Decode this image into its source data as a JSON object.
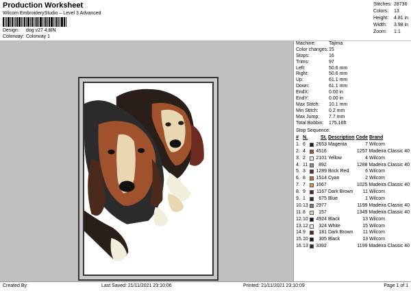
{
  "header": {
    "title": "Production Worksheet",
    "subtitle": "Wilcom EmbroideryStudio – Level 3 Advanced",
    "design_label": "Design:",
    "design_value": "dog v27 4,8IN",
    "colorway_label": "Colorway:",
    "colorway_value": "Colorway 1"
  },
  "stats": [
    {
      "k": "Stitches:",
      "v": "28736"
    },
    {
      "k": "Colors:",
      "v": "13"
    },
    {
      "k": "Height:",
      "v": "4.81 in"
    },
    {
      "k": "Width:",
      "v": "3.98 in"
    },
    {
      "k": "Zoom:",
      "v": "1:1"
    }
  ],
  "properties": [
    {
      "k": "Machine:",
      "v": "Tajima"
    },
    {
      "k": "Color changes:",
      "v": "15"
    },
    {
      "k": "Stops:",
      "v": "16"
    },
    {
      "k": "Trims:",
      "v": "97"
    },
    {
      "k": "Left:",
      "v": "50.6 mm"
    },
    {
      "k": "Right:",
      "v": "50.6 mm"
    },
    {
      "k": "Up:",
      "v": "61.1 mm"
    },
    {
      "k": "Down:",
      "v": "61.1 mm"
    },
    {
      "k": "EndX:",
      "v": "0.00 in"
    },
    {
      "k": "EndY:",
      "v": "0.00 in"
    },
    {
      "k": "Max Stitch:",
      "v": "10.1 mm"
    },
    {
      "k": "Min Stitch:",
      "v": "0.2 mm"
    },
    {
      "k": "Max Jump:",
      "v": "7.7 mm"
    },
    {
      "k": "Total Bobbin:",
      "v": "175.16ft"
    }
  ],
  "stop_sequence": {
    "title": "Stop Sequence:",
    "headers": {
      "num": "#",
      "n": "N.",
      "st": "St.",
      "desc": "Description",
      "code": "Code",
      "brand": "Brand"
    },
    "rows": [
      {
        "num": "1.",
        "n": "6",
        "color": "#2a1e18",
        "st": "2653",
        "desc": "Magenta",
        "code": "7",
        "brand": "Wilcom"
      },
      {
        "num": "2.",
        "n": "4",
        "color": "#a0522d",
        "st": "4516",
        "desc": "",
        "code": "1257",
        "brand": "Madeira Classic 40"
      },
      {
        "num": "3.",
        "n": "2",
        "color": "#f2f0dc",
        "st": "2101",
        "desc": "Yellow",
        "code": "4",
        "brand": "Wilcom"
      },
      {
        "num": "4.",
        "n": "11",
        "color": "#8a8a8a",
        "st": "892",
        "desc": "",
        "code": "1288",
        "brand": "Madeira Classic 40"
      },
      {
        "num": "5.",
        "n": "3",
        "color": "#6b2a20",
        "st": "1289",
        "desc": "Brick Red",
        "code": "6",
        "brand": "Wilcom"
      },
      {
        "num": "6.",
        "n": "8",
        "color": "#c46a3a",
        "st": "1514",
        "desc": "Cyan",
        "code": "2",
        "brand": "Wilcom"
      },
      {
        "num": "7.",
        "n": "7",
        "color": "#d9904e",
        "st": "1667",
        "desc": "",
        "code": "1025",
        "brand": "Madeira Classic 40"
      },
      {
        "num": "8.",
        "n": "9",
        "color": "#4a2a1a",
        "st": "1167",
        "desc": "Dark Brown",
        "code": "11",
        "brand": "Wilcom"
      },
      {
        "num": "9.",
        "n": "1",
        "color": "#2b2b2b",
        "st": "675",
        "desc": "Blue",
        "code": "1",
        "brand": "Wilcom"
      },
      {
        "num": "10.",
        "n": "13",
        "color": "#6e7a80",
        "st": "2977",
        "desc": "",
        "code": "1199",
        "brand": "Madeira Classic 40"
      },
      {
        "num": "11.",
        "n": "8",
        "color": "#e8d7b0",
        "st": "157",
        "desc": "",
        "code": "1349",
        "brand": "Madeira Classic 40"
      },
      {
        "num": "12.",
        "n": "10",
        "color": "#111111",
        "st": "4924",
        "desc": "Black",
        "code": "13",
        "brand": "Wilcom"
      },
      {
        "num": "13.",
        "n": "12",
        "color": "#ffffff",
        "st": "324",
        "desc": "White",
        "code": "15",
        "brand": "Wilcom"
      },
      {
        "num": "14.",
        "n": "9",
        "color": "#4a2a1a",
        "st": "181",
        "desc": "Dark Brown",
        "code": "11",
        "brand": "Wilcom"
      },
      {
        "num": "15.",
        "n": "10",
        "color": "#111111",
        "st": "305",
        "desc": "Black",
        "code": "13",
        "brand": "Wilcom"
      },
      {
        "num": "16.",
        "n": "13",
        "color": "#2b2b2b",
        "st": "3392",
        "desc": "",
        "code": "1199",
        "brand": "Madeira Classic 40"
      }
    ]
  },
  "footer": {
    "created_by": "Created By:",
    "last_saved": "Last Saved: 21/11/2021 23:10:06",
    "printed": "Printed: 21/11/2021 23:10:09",
    "page": "Page 1 of 1"
  }
}
